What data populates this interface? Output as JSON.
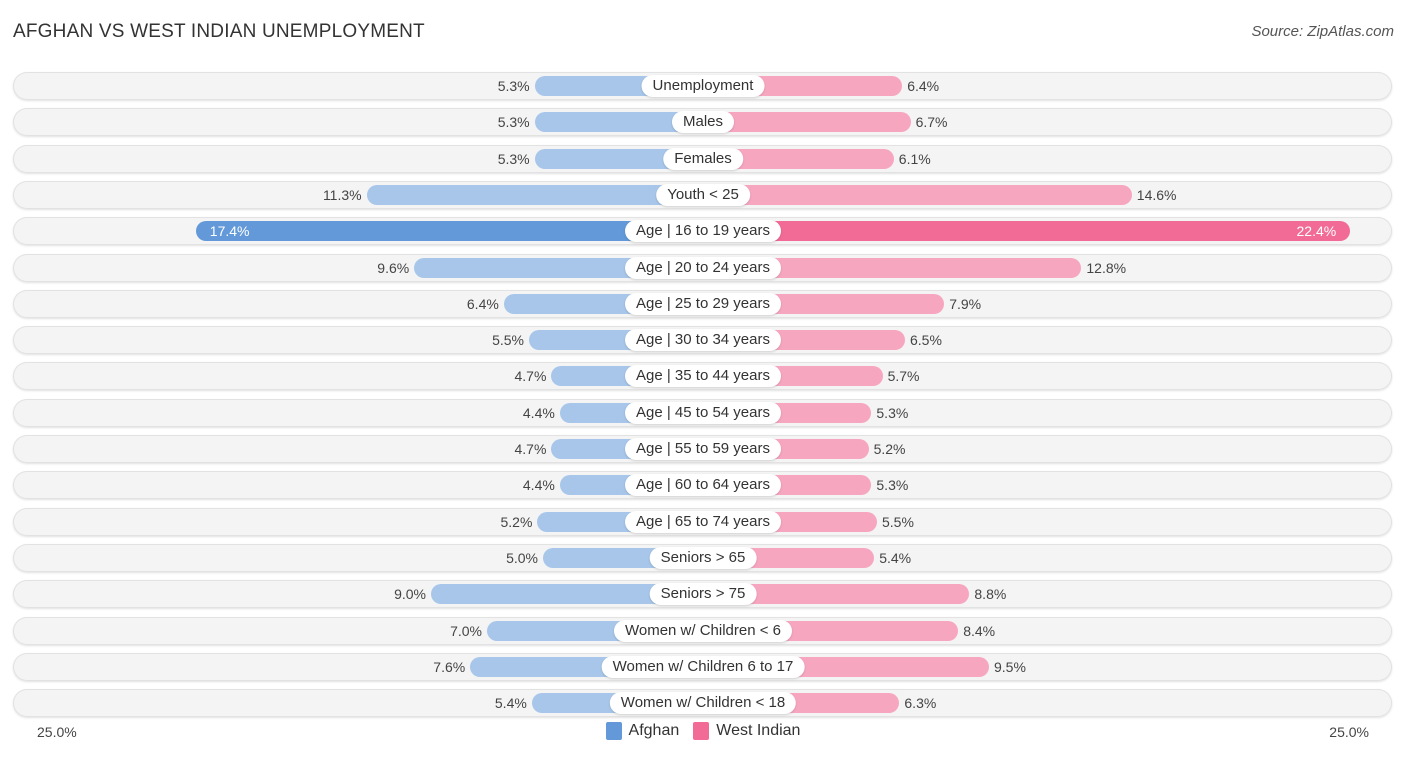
{
  "chart_data": {
    "type": "bar",
    "orientation": "horizontal-diverging",
    "title": "AFGHAN VS WEST INDIAN UNEMPLOYMENT",
    "source": "Source: ZipAtlas.com",
    "axis_min_label": "25.0%",
    "axis_max_label": "25.0%",
    "xlim": [
      0,
      25
    ],
    "legend_placement": "bottom-center",
    "categories": [
      "Unemployment",
      "Males",
      "Females",
      "Youth < 25",
      "Age | 16 to 19 years",
      "Age | 20 to 24 years",
      "Age | 25 to 29 years",
      "Age | 30 to 34 years",
      "Age | 35 to 44 years",
      "Age | 45 to 54 years",
      "Age | 55 to 59 years",
      "Age | 60 to 64 years",
      "Age | 65 to 74 years",
      "Seniors > 65",
      "Seniors > 75",
      "Women w/ Children < 6",
      "Women w/ Children 6 to 17",
      "Women w/ Children < 18"
    ],
    "series": [
      {
        "name": "Afghan",
        "color": "#6399d9",
        "values": [
          5.3,
          5.3,
          5.3,
          11.3,
          17.4,
          9.6,
          6.4,
          5.5,
          4.7,
          4.4,
          4.7,
          4.4,
          5.2,
          5.0,
          9.0,
          7.0,
          7.6,
          5.4
        ]
      },
      {
        "name": "West Indian",
        "color": "#f26b96",
        "values": [
          6.4,
          6.7,
          6.1,
          14.6,
          22.4,
          12.8,
          7.9,
          6.5,
          5.7,
          5.3,
          5.2,
          5.3,
          5.5,
          5.4,
          8.8,
          8.4,
          9.5,
          6.3
        ]
      }
    ],
    "value_labels_left": [
      "5.3%",
      "5.3%",
      "5.3%",
      "11.3%",
      "17.4%",
      "9.6%",
      "6.4%",
      "5.5%",
      "4.7%",
      "4.4%",
      "4.7%",
      "4.4%",
      "5.2%",
      "5.0%",
      "9.0%",
      "7.0%",
      "7.6%",
      "5.4%"
    ],
    "value_labels_right": [
      "6.4%",
      "6.7%",
      "6.1%",
      "14.6%",
      "22.4%",
      "12.8%",
      "7.9%",
      "6.5%",
      "5.7%",
      "5.3%",
      "5.2%",
      "5.3%",
      "5.5%",
      "5.4%",
      "8.8%",
      "8.4%",
      "9.5%",
      "6.3%"
    ],
    "highlight_index": 4
  }
}
